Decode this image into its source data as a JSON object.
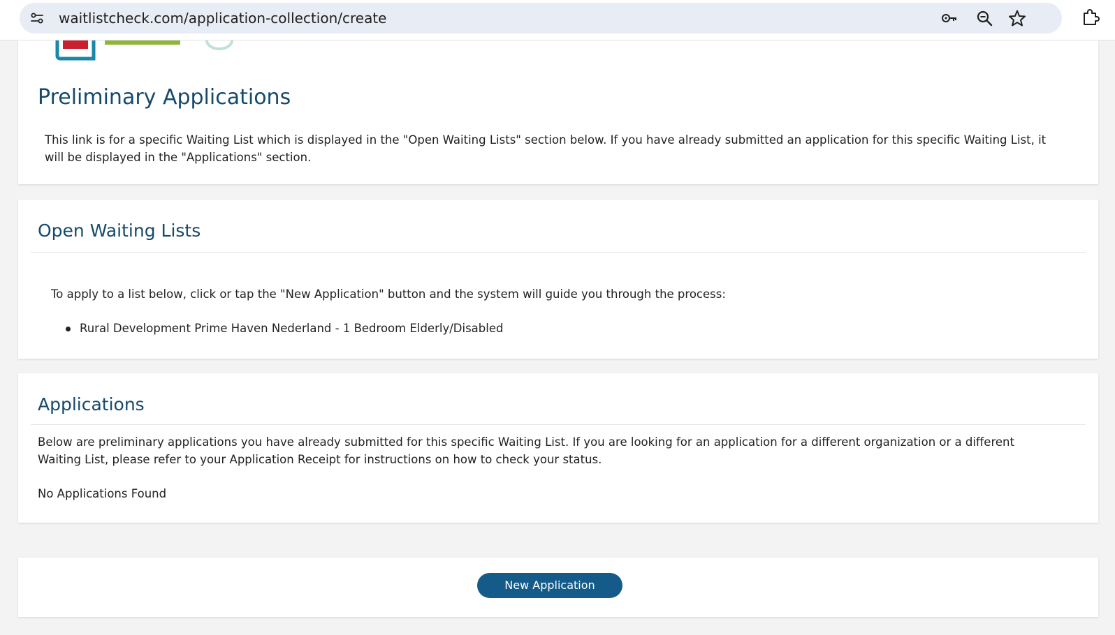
{
  "browser": {
    "url": "waitlistcheck.com/application-collection/create"
  },
  "prelim": {
    "title": "Preliminary Applications",
    "description": "This link is for a specific Waiting List which is displayed in the \"Open Waiting Lists\" section below. If you have already submitted an application for this specific Waiting List, it will be displayed in the \"Applications\" section."
  },
  "open_lists": {
    "title": "Open Waiting Lists",
    "instructions": "To apply to a list below, click or tap the \"New Application\" button and the system will guide you through the process:",
    "items": [
      "Rural Development Prime Haven Nederland - 1 Bedroom Elderly/Disabled"
    ]
  },
  "applications": {
    "title": "Applications",
    "description": "Below are preliminary applications you have already submitted for this specific Waiting List. If you are looking for an application for a different organization or a different Waiting List, please refer to your Application Receipt for instructions on how to check your status.",
    "empty_message": "No Applications Found"
  },
  "actions": {
    "new_application_label": "New Application"
  },
  "colors": {
    "heading": "#164a6b",
    "button": "#155b8a",
    "omnibox": "#e8ecf5"
  }
}
